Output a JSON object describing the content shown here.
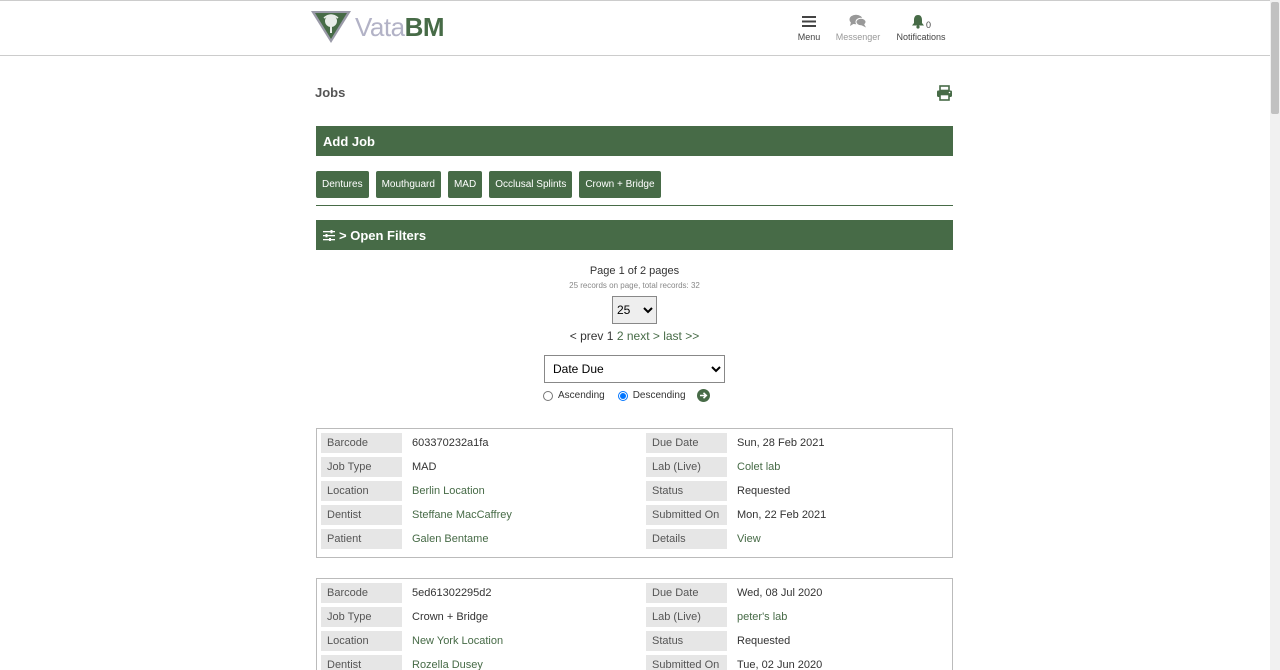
{
  "app": {
    "logo_vata": "Vata",
    "logo_bm": "BM",
    "brand_color": "#476b47"
  },
  "nav": {
    "menu_label": "Menu",
    "messenger_label": "Messenger",
    "notifications_label": "Notifications",
    "notifications_count": "0"
  },
  "page": {
    "title": "Jobs",
    "print_icon": "print-icon"
  },
  "add_job": {
    "heading": "Add Job",
    "buttons": [
      "Dentures",
      "Mouthguard",
      "MAD",
      "Occlusal Splints",
      "Crown + Bridge"
    ]
  },
  "filters": {
    "label": "> Open Filters",
    "icon": "sliders-icon"
  },
  "pagination": {
    "title": "Page 1 of 2 pages",
    "subtitle": "25 records on page, total records: 32",
    "per_page": "25",
    "prev": "< prev",
    "current": "1",
    "page2": "2",
    "next": "next >",
    "last": "last >>"
  },
  "sort": {
    "selected": "Date Due",
    "ascending_label": "Ascending",
    "descending_label": "Descending",
    "order": "Descending"
  },
  "jobs": [
    {
      "barcode_label": "Barcode",
      "barcode": "603370232a1fa",
      "job_type_label": "Job Type",
      "job_type": "MAD",
      "location_label": "Location",
      "location": "Berlin Location",
      "dentist_label": "Dentist",
      "dentist": "Steffane MacCaffrey",
      "patient_label": "Patient",
      "patient": "Galen Bentame",
      "due_date_label": "Due Date",
      "due_date": "Sun, 28 Feb 2021",
      "lab_label": "Lab (Live)",
      "lab": "Colet lab",
      "status_label": "Status",
      "status": "Requested",
      "submitted_label": "Submitted On",
      "submitted": "Mon, 22 Feb 2021",
      "details_label": "Details",
      "details": "View"
    },
    {
      "barcode_label": "Barcode",
      "barcode": "5ed61302295d2",
      "job_type_label": "Job Type",
      "job_type": "Crown + Bridge",
      "location_label": "Location",
      "location": "New York Location",
      "dentist_label": "Dentist",
      "dentist": "Rozella Dusey",
      "due_date_label": "Due Date",
      "due_date": "Wed, 08 Jul 2020",
      "lab_label": "Lab (Live)",
      "lab": "peter's lab",
      "status_label": "Status",
      "status": "Requested",
      "submitted_label": "Submitted On",
      "submitted": "Tue, 02 Jun 2020"
    }
  ]
}
